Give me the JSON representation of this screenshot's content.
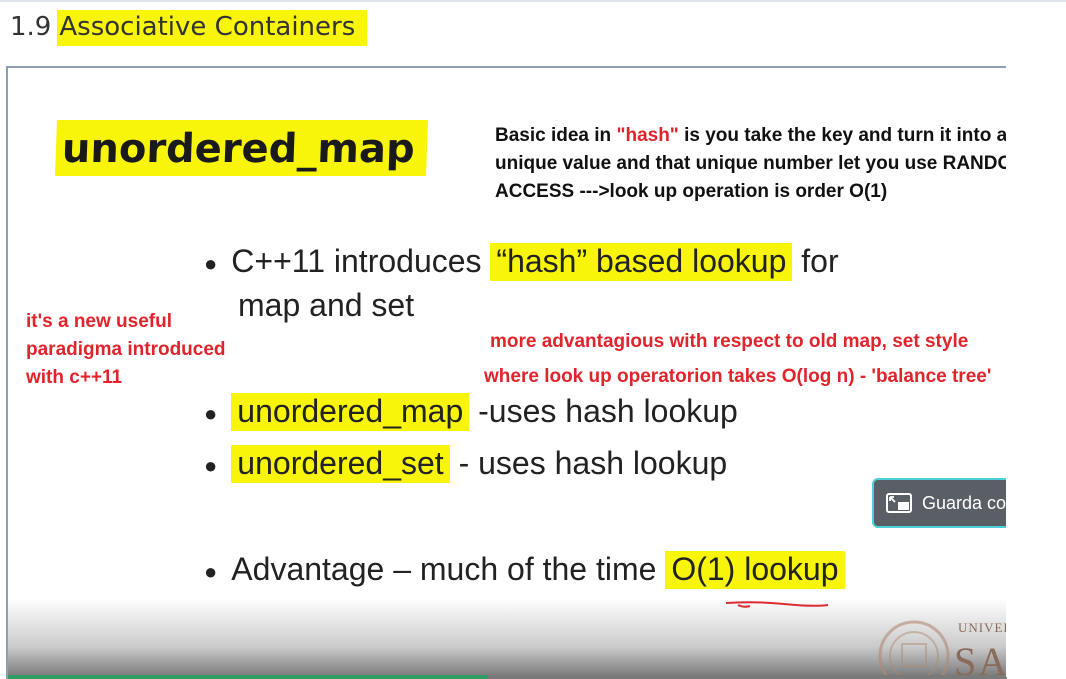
{
  "header": {
    "section_number": "1.9",
    "section_title": "Associative Containers"
  },
  "slide": {
    "title": "unordered_map",
    "note_top": {
      "part1": "Basic idea in ",
      "hash_word": "\"hash\"",
      "part2": " is you take the key and turn it into an unique value and that unique number let you use RANDOM ACCESS --->look up operation is order O(1)"
    },
    "bullet1": {
      "pre": "C++11 introduces ",
      "highlight": "“hash” based lookup",
      "post": " for",
      "line2": "map and set"
    },
    "note_left": {
      "line1": "it's a new useful",
      "line2": "paradigma introduced",
      "line3": "with c++11"
    },
    "note_middle": {
      "line1": "more advantagious with respect to old map, set style",
      "line2": "where look up operatorion takes O(log n) - 'balance tree'"
    },
    "bullet2": {
      "highlight": "unordered_map",
      "post": " -uses hash lookup"
    },
    "bullet3": {
      "highlight": "unordered_set",
      "post": "  - uses hash lookup"
    },
    "bullet4": {
      "pre": "Advantage – much of the time ",
      "highlight": "O(1) lookup"
    },
    "bullet_glyph": "●"
  },
  "player": {
    "pip_label": "Guarda con",
    "pip_icon": "picture-in-picture-icon",
    "progress_fraction": 0.48,
    "logo_small": "UNIVERS",
    "logo_big": "SAN"
  },
  "colors": {
    "highlight": "#f8f50a",
    "note_red": "#e0242c",
    "progress": "#2e9e63",
    "pip_border": "#4dd0d8"
  }
}
